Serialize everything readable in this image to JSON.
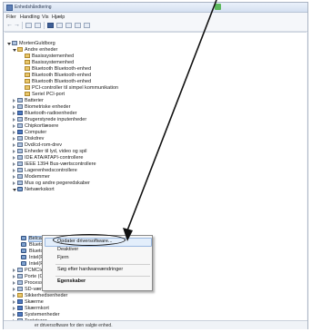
{
  "window": {
    "title": "Enhedshåndtering"
  },
  "menu": [
    "Filer",
    "Handling",
    "Vis",
    "Hjælp"
  ],
  "toolbar": {
    "icons": [
      "back-arrow-icon",
      "forward-arrow-icon",
      "properties-icon",
      "list-icon",
      "help-icon",
      "update-icon",
      "scan-icon",
      "disable-icon",
      "uninstall-icon"
    ]
  },
  "tree": {
    "root": "MortenGuldborg",
    "items": [
      {
        "label": "Andre enheder",
        "open": true
      },
      {
        "label": "Basissystemenhed"
      },
      {
        "label": "Basissystemenhed"
      },
      {
        "label": "Bluetooth Bluetooth-enhed"
      },
      {
        "label": "Bluetooth Bluetooth-enhed"
      },
      {
        "label": "Bluetooth Bluetooth-enhed"
      },
      {
        "label": "PCI-controller til simpel kommunikation"
      },
      {
        "label": "Seriel PCI-port"
      },
      {
        "label": "Batterier"
      },
      {
        "label": "Biometriske enheder"
      },
      {
        "label": "Bluetooth-radioenheder"
      },
      {
        "label": "Brugerstyrede inputenheder"
      },
      {
        "label": "Chipkortlæsere"
      },
      {
        "label": "Computer"
      },
      {
        "label": "Diskdrev"
      },
      {
        "label": "Dvd/cd-rom-drev"
      },
      {
        "label": "Enheder til lyd, video og spil"
      },
      {
        "label": "IDE ATA/ATAPI-controllere"
      },
      {
        "label": "IEEE 1394 Bus-værtscontrollere"
      },
      {
        "label": "Lagerenhedscontrollere"
      },
      {
        "label": "Modemmer"
      },
      {
        "label": "Mus og andre pegeredskaber"
      },
      {
        "label": "Netværkskort",
        "open": true
      },
      {
        "label": "Belcamp"
      },
      {
        "label": "Bluetoo"
      },
      {
        "label": "Bluetoo"
      },
      {
        "label": "Intel(R)"
      },
      {
        "label": "Intel(R)"
      },
      {
        "label": "PCMCIA-ad"
      },
      {
        "label": "Porte (COM"
      },
      {
        "label": "Processorer"
      },
      {
        "label": "SD-værtsadaptere"
      },
      {
        "label": "Sikkerhedsenheder"
      },
      {
        "label": "Skærme"
      },
      {
        "label": "Skærmkort"
      },
      {
        "label": "Systemenheder"
      },
      {
        "label": "Tastaturer"
      },
      {
        "label": "USB-controllere (Universal Serial Bus)"
      }
    ]
  },
  "context_menu": {
    "items": [
      "Opdater driversoftware...",
      "Deaktiver",
      "Fjern",
      "Søg efter hardwareændringer",
      "Egenskaber"
    ]
  },
  "status": {
    "text": "er driversoftware for den valgte enhed."
  }
}
